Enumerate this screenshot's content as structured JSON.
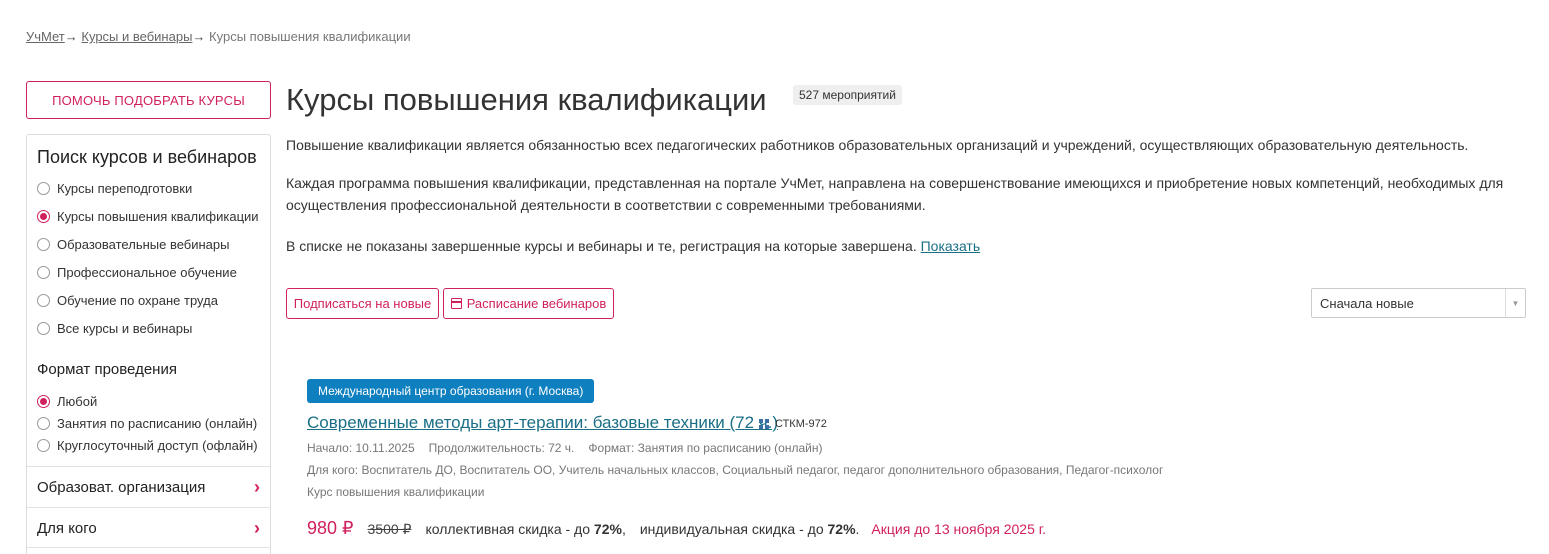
{
  "breadcrumb": {
    "items": [
      "УчМет",
      "Курсы и вебинары"
    ],
    "separator": "→",
    "current": "Курсы повышения квалификации"
  },
  "help_button": "ПОМОЧЬ ПОДОБРАТЬ КУРСЫ",
  "sidebar": {
    "search_title": "Поиск курсов и вебинаров",
    "types": [
      {
        "label": "Курсы переподготовки",
        "checked": false
      },
      {
        "label": "Курсы повышения квалификации",
        "checked": true
      },
      {
        "label": "Образовательные вебинары",
        "checked": false
      },
      {
        "label": "Профессиональное обучение",
        "checked": false
      },
      {
        "label": "Обучение по охране труда",
        "checked": false
      },
      {
        "label": "Все курсы и вебинары",
        "checked": false
      }
    ],
    "format_title": "Формат проведения",
    "formats": [
      {
        "label": "Любой",
        "checked": true
      },
      {
        "label": "Занятия по расписанию (онлайн)",
        "checked": false
      },
      {
        "label": "Круглосуточный доступ (офлайн)",
        "checked": false
      }
    ],
    "filters": [
      "Образоват. организация",
      "Для кого"
    ]
  },
  "main": {
    "title": "Курсы повышения квалификации",
    "count_badge": "527 мероприятий",
    "intro_1": "Повышение квалификации является обязанностью всех педагогических работников образовательных организаций и учреждений, осуществляющих образовательную деятельность.",
    "intro_2": "Каждая программа повышения квалификации, представленная на портале УчМет, направлена на совершенствование имеющихся и приобретение новых компетенций, необходимых для осуществления профессиональной деятельности в соответствии с современными требованиями.",
    "notice": "В списке не показаны завершенные курсы и вебинары и те, регистрация на которые завершена.",
    "notice_link": "Показать",
    "subscribe_button": "Подписаться на новые",
    "schedule_button": "Расписание вебинаров",
    "sort_value": "Сначала новые"
  },
  "course": {
    "org_badge": "Международный центр образования (г. Москва)",
    "title": "Современные методы арт-терапии: базовые техники (72 ч.)",
    "code": "СТКМ-972",
    "start": "Начало: 10.11.2025",
    "duration": "Продолжительность: 72 ч.",
    "format": "Формат: Занятия по расписанию (онлайн)",
    "audience": "Для кого: Воспитатель ДО, Воспитатель ОО, Учитель начальных классов, Социальный педагог, педагог дополнительного образования, Педагог-психолог",
    "type": "Курс повышения квалификации",
    "price": "980 ₽",
    "old_price": "3500 ₽",
    "collective_discount_label": "коллективная скидка - до",
    "collective_discount_value": "72%",
    "individual_discount_label": "индивидуальная скидка - до",
    "individual_discount_value": "72%",
    "promo": "Акция до 13 ноября 2025 г."
  },
  "colors": {
    "accent": "#d0215f",
    "link": "#1a6f86",
    "badge_blue": "#0e7fbf"
  }
}
